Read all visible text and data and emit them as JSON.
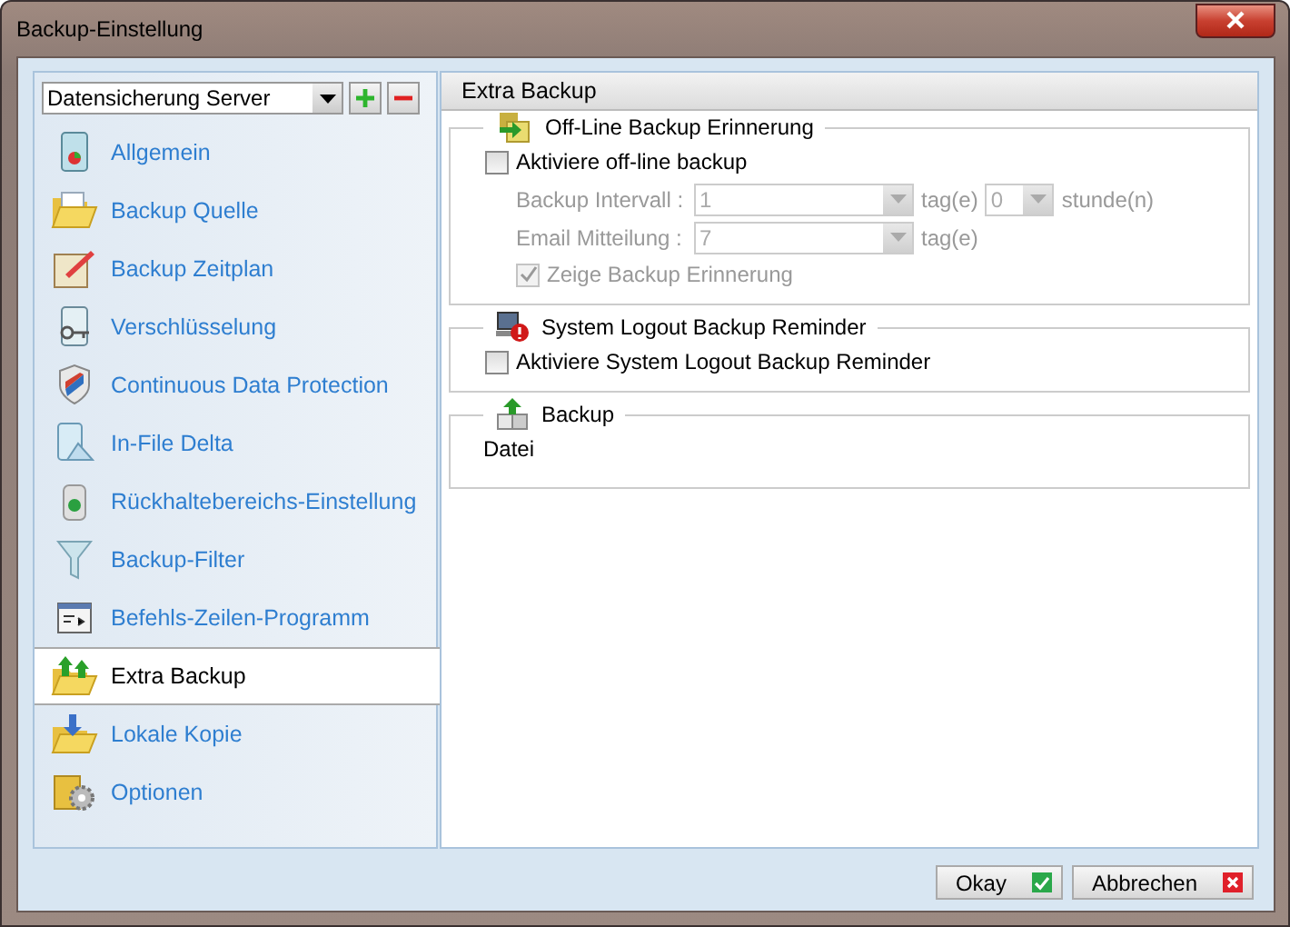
{
  "window": {
    "title": "Backup-Einstellung"
  },
  "profile_select": {
    "value": "Datensicherung Server"
  },
  "sidebar": {
    "items": [
      {
        "label": "Allgemein",
        "selected": false
      },
      {
        "label": "Backup Quelle",
        "selected": false
      },
      {
        "label": "Backup Zeitplan",
        "selected": false
      },
      {
        "label": "Verschlüsselung",
        "selected": false
      },
      {
        "label": "Continuous Data Protection",
        "selected": false
      },
      {
        "label": "In-File Delta",
        "selected": false
      },
      {
        "label": "Rückhaltebereichs-Einstellung",
        "selected": false
      },
      {
        "label": "Backup-Filter",
        "selected": false
      },
      {
        "label": "Befehls-Zeilen-Programm",
        "selected": false
      },
      {
        "label": "Extra Backup",
        "selected": true
      },
      {
        "label": "Lokale Kopie",
        "selected": false
      },
      {
        "label": "Optionen",
        "selected": false
      }
    ]
  },
  "panel": {
    "title": "Extra Backup",
    "offline": {
      "title": "Off-Line Backup Erinnerung",
      "enable": {
        "label": "Aktiviere off-line backup",
        "checked": false
      },
      "interval": {
        "label": "Backup Intervall :",
        "value": "1",
        "unit": "tag(e)",
        "hours_value": "0",
        "hours_unit": "stunde(n)",
        "disabled": true
      },
      "email": {
        "label": "Email Mitteilung :",
        "value": "7",
        "unit": "tag(e)",
        "disabled": true
      },
      "show_reminder": {
        "label": "Zeige Backup Erinnerung",
        "checked": true,
        "disabled": true
      }
    },
    "logout": {
      "title": "System Logout Backup Reminder",
      "enable": {
        "label": "Aktiviere System Logout Backup Reminder",
        "checked": false
      }
    },
    "backup": {
      "title": "Backup",
      "text": "Datei"
    }
  },
  "buttons": [
    {
      "label": "Okay",
      "kind": "ok"
    },
    {
      "label": "Abbrechen",
      "kind": "cancel"
    }
  ]
}
